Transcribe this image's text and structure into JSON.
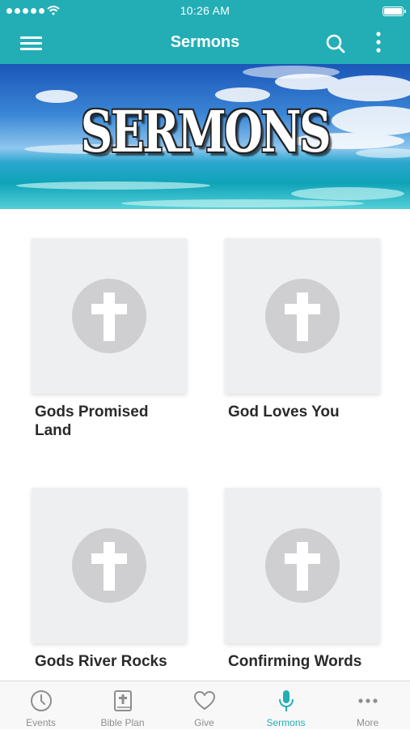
{
  "status_bar": {
    "time": "10:26 AM",
    "icons": [
      "signal-dots-icon",
      "wifi-icon",
      "battery-icon"
    ]
  },
  "nav": {
    "title": "Sermons",
    "icons": [
      "hamburger-menu-icon",
      "search-icon",
      "more-vertical-icon"
    ]
  },
  "banner": {
    "text": "SERMONS",
    "image": "ocean-sky-banner"
  },
  "sermons": [
    {
      "title": "Gods Promised Land",
      "thumbnail_icon": "cross-icon"
    },
    {
      "title": "God Loves You",
      "thumbnail_icon": "cross-icon"
    },
    {
      "title": "Gods River Rocks",
      "thumbnail_icon": "cross-icon"
    },
    {
      "title": "Confirming Words",
      "thumbnail_icon": "cross-icon"
    }
  ],
  "tabs": [
    {
      "label": "Events",
      "icon": "clock-icon",
      "active": false
    },
    {
      "label": "Bible Plan",
      "icon": "bible-icon",
      "active": false
    },
    {
      "label": "Give",
      "icon": "heart-icon",
      "active": false
    },
    {
      "label": "Sermons",
      "icon": "microphone-icon",
      "active": true
    },
    {
      "label": "More",
      "icon": "more-horizontal-icon",
      "active": false
    }
  ],
  "colors": {
    "accent": "#23aeb6",
    "tab_inactive": "#8e8e8e",
    "thumbnail_bg": "#eeeff1",
    "cross_circle": "#cfcfd1"
  }
}
